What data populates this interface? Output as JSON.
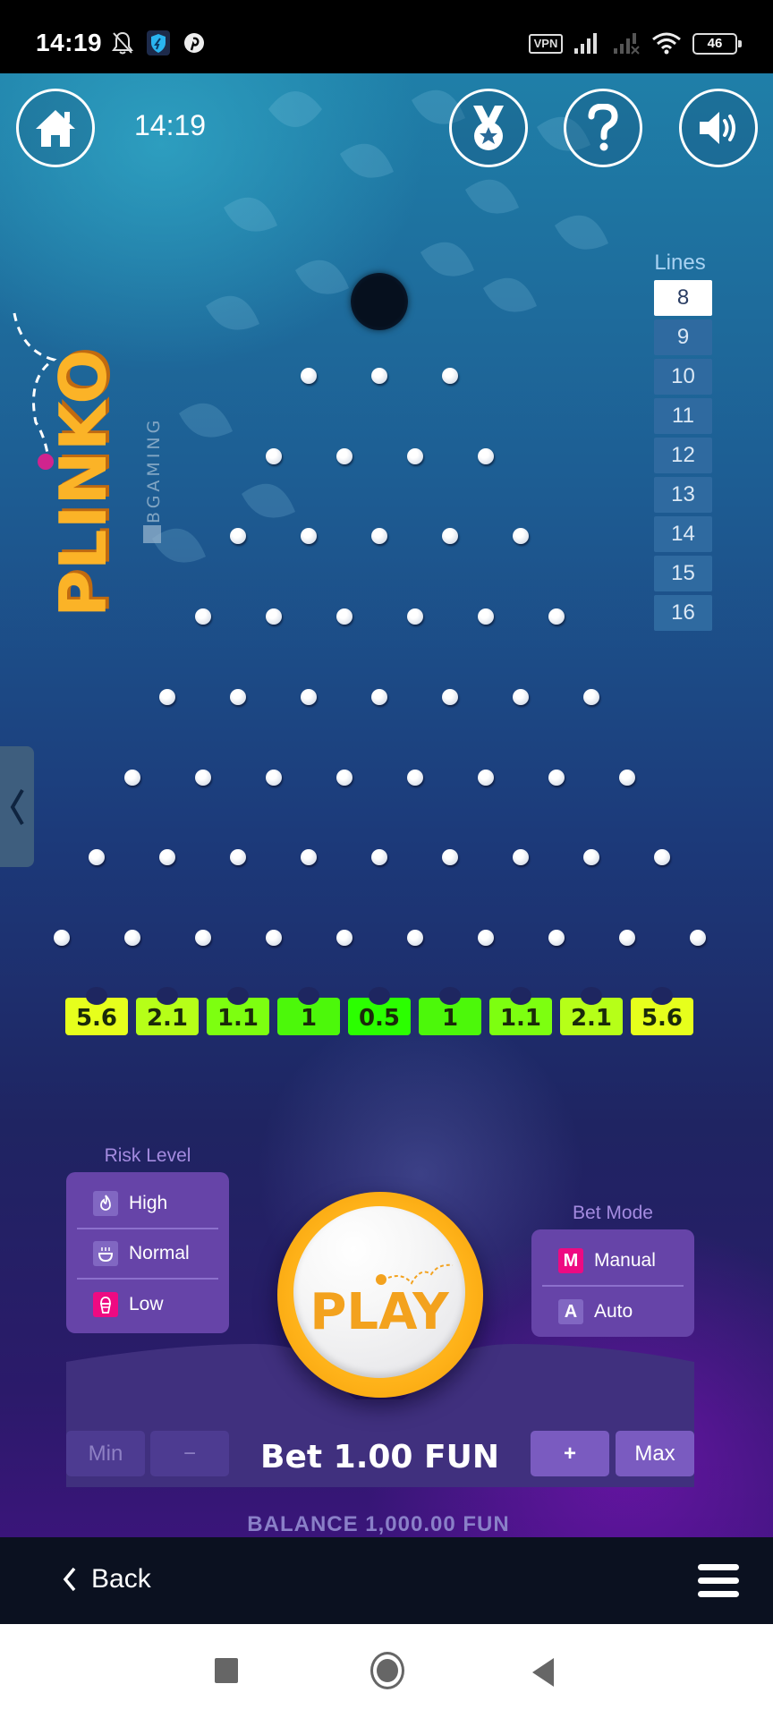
{
  "status_bar": {
    "time": "14:19",
    "left_icons": [
      "bell-off-icon",
      "vpn-shield-app-icon",
      "pinterest-icon"
    ],
    "vpn_label": "VPN",
    "right_icons": [
      "signal-icon",
      "signal-no-service-icon",
      "wifi-icon"
    ],
    "battery": "46"
  },
  "game": {
    "title": "PLINKO",
    "provider": "BGAMING",
    "clock": "14:19",
    "top_buttons": [
      {
        "name": "home",
        "icon": "home-icon"
      },
      {
        "name": "achievements",
        "icon": "medal-icon"
      },
      {
        "name": "help",
        "icon": "question-icon"
      },
      {
        "name": "sound",
        "icon": "speaker-icon"
      }
    ],
    "lines": {
      "label": "Lines",
      "options": [
        "8",
        "9",
        "10",
        "11",
        "12",
        "13",
        "14",
        "15",
        "16"
      ],
      "selected": "8"
    },
    "board": {
      "rows": 8,
      "pegs_per_row": [
        3,
        4,
        5,
        6,
        7,
        8,
        9,
        10
      ]
    },
    "multipliers": [
      {
        "value": "5.6",
        "color": "#e6ff1c"
      },
      {
        "value": "2.1",
        "color": "#b6ff18"
      },
      {
        "value": "1.1",
        "color": "#7dff10"
      },
      {
        "value": "1",
        "color": "#4cf80a"
      },
      {
        "value": "0.5",
        "color": "#2bff00"
      },
      {
        "value": "1",
        "color": "#4cf80a"
      },
      {
        "value": "1.1",
        "color": "#7dff10"
      },
      {
        "value": "2.1",
        "color": "#b6ff18"
      },
      {
        "value": "5.6",
        "color": "#e6ff1c"
      }
    ],
    "risk": {
      "label": "Risk Level",
      "options": [
        {
          "label": "High",
          "icon": "flame-icon"
        },
        {
          "label": "Normal",
          "icon": "cup-icon"
        },
        {
          "label": "Low",
          "icon": "ice-cream-icon"
        }
      ],
      "selected": "Low"
    },
    "bet_mode": {
      "label": "Bet Mode",
      "options": [
        {
          "label": "Manual",
          "badge": "M"
        },
        {
          "label": "Auto",
          "badge": "A"
        }
      ],
      "selected": "Manual"
    },
    "play_label": "PLAY",
    "bet": {
      "min_label": "Min",
      "minus_label": "−",
      "plus_label": "+",
      "max_label": "Max",
      "text": "Bet 1.00 FUN"
    },
    "balance": "BALANCE 1,000.00 FUN",
    "accent_colors": {
      "selected": "#ee0a82",
      "play_ring": "#ffb31a",
      "play_text": "#f3a21e"
    }
  },
  "web_nav": {
    "back_label": "Back",
    "menu_icon": "hamburger-icon"
  },
  "system_nav": [
    "recent-apps",
    "home",
    "back"
  ]
}
